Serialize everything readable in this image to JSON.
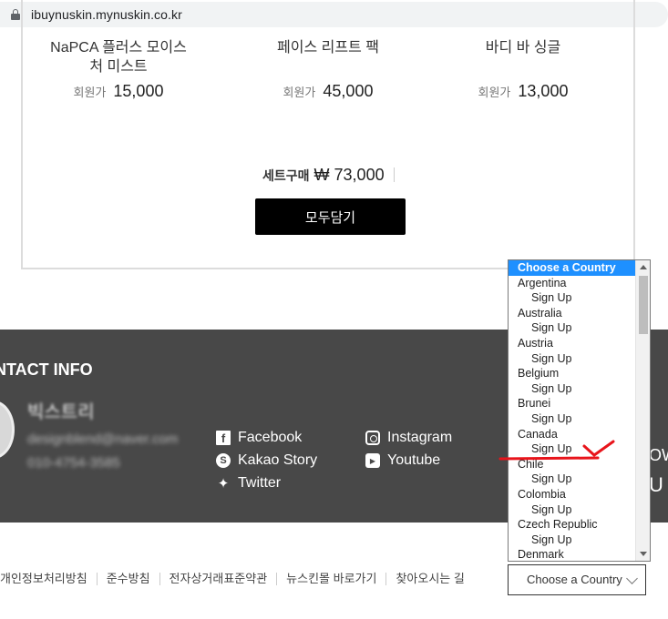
{
  "browser": {
    "url": "ibuynuskin.mynuskin.co.kr"
  },
  "products": [
    {
      "name": "NaPCA 플러스 모이스처 미스트",
      "price_label": "회원가",
      "price": "15,000"
    },
    {
      "name": "페이스 리프트 팩",
      "price_label": "회원가",
      "price": "45,000"
    },
    {
      "name": "바디 바 싱글",
      "price_label": "회원가",
      "price": "13,000"
    }
  ],
  "set": {
    "label": "세트구매",
    "total": "₩ 73,000",
    "add_all_label": "모두담기"
  },
  "footer": {
    "contact_title": "NTACT INFO",
    "brand_name": "빅스트리",
    "email": "designblend@naver.com",
    "phone": "010-4754-3585",
    "social": [
      {
        "label": "Facebook",
        "icon": "facebook-icon"
      },
      {
        "label": "Kakao Story",
        "icon": "kakao-story-icon"
      },
      {
        "label": "Twitter",
        "icon": "twitter-icon"
      },
      {
        "label": "Instagram",
        "icon": "instagram-icon"
      },
      {
        "label": "Youtube",
        "icon": "youtube-icon"
      }
    ],
    "side_text_1": "OW",
    "side_text_2": "U"
  },
  "links": [
    "개인정보처리방침",
    "준수방침",
    "전자상거래표준약관",
    "뉴스킨몰 바로가기",
    "찾아오시는 길"
  ],
  "country_select": {
    "value": "Choose a Country",
    "options": [
      {
        "label": "Choose a Country",
        "selected": true
      },
      {
        "label": "Argentina"
      },
      {
        "label": "Sign Up",
        "sub": true
      },
      {
        "label": "Australia"
      },
      {
        "label": "Sign Up",
        "sub": true
      },
      {
        "label": "Austria"
      },
      {
        "label": "Sign Up",
        "sub": true
      },
      {
        "label": "Belgium"
      },
      {
        "label": "Sign Up",
        "sub": true
      },
      {
        "label": "Brunei"
      },
      {
        "label": "Sign Up",
        "sub": true
      },
      {
        "label": "Canada"
      },
      {
        "label": "Sign Up",
        "sub": true
      },
      {
        "label": "Chile"
      },
      {
        "label": "Sign Up",
        "sub": true
      },
      {
        "label": "Colombia"
      },
      {
        "label": "Sign Up",
        "sub": true
      },
      {
        "label": "Czech Republic"
      },
      {
        "label": "Sign Up",
        "sub": true
      },
      {
        "label": "Denmark"
      }
    ]
  },
  "colors": {
    "footer_bg": "#484848",
    "select_highlight": "#1e90ff",
    "annotation": "#e8141b"
  }
}
